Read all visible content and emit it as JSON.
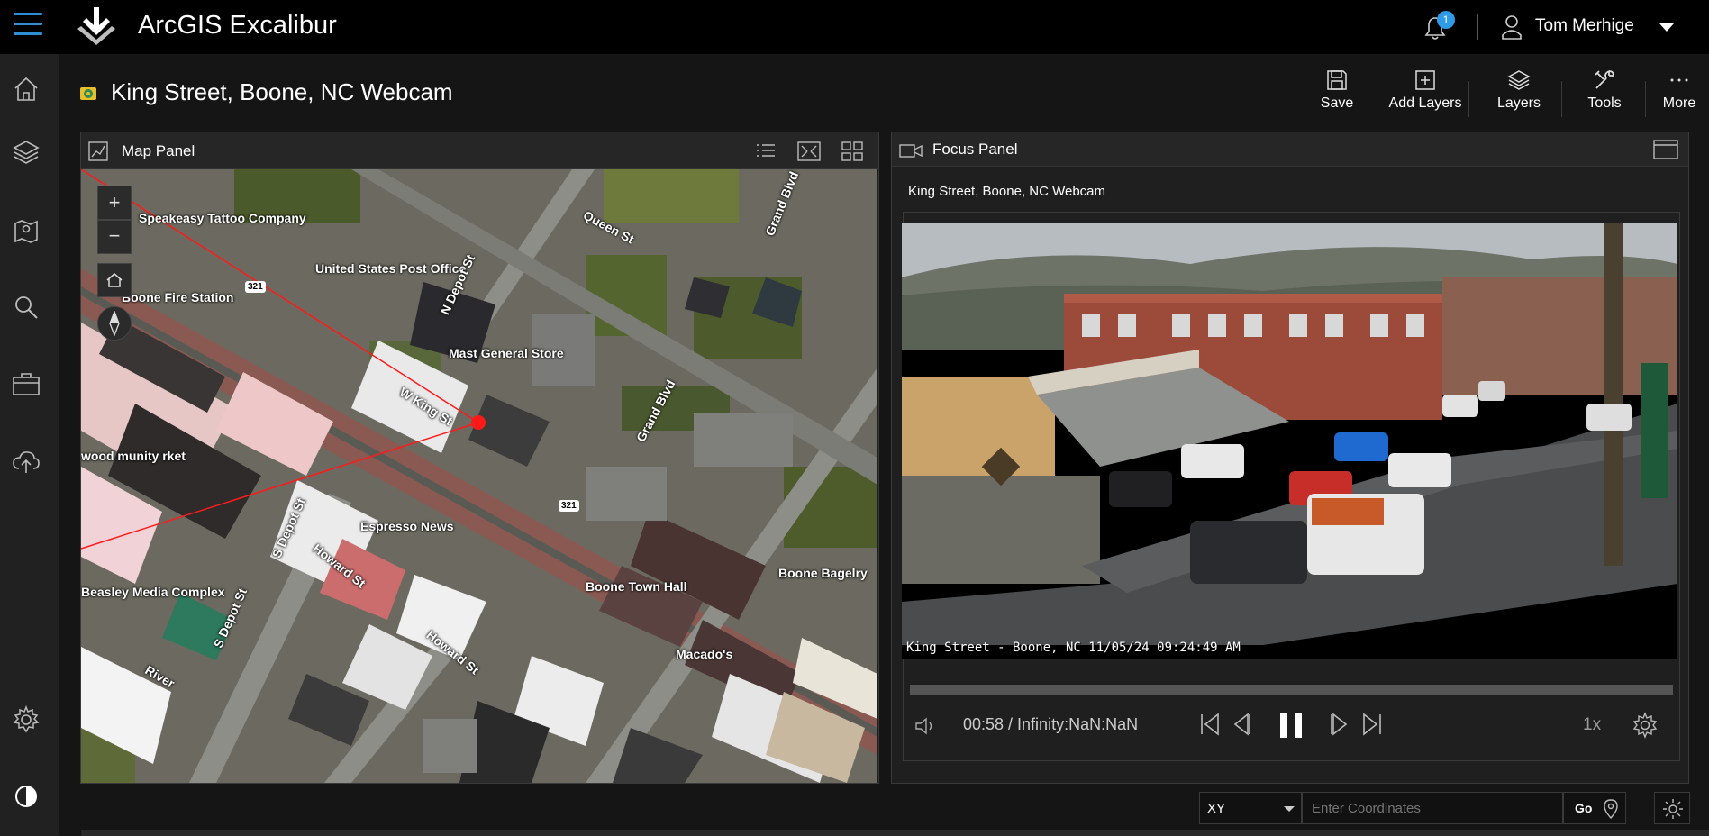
{
  "app": {
    "title": "ArcGIS Excalibur"
  },
  "notifications": {
    "count": "1"
  },
  "user": {
    "name": "Tom Merhige"
  },
  "page": {
    "title": "King Street, Boone, NC Webcam"
  },
  "toolbar": {
    "save": "Save",
    "add_layers": "Add Layers",
    "layers": "Layers",
    "tools": "Tools",
    "more": "More"
  },
  "map_panel": {
    "title": "Map Panel",
    "labels": {
      "speakeasy": "Speakeasy Tattoo Company",
      "post_office": "United States Post Office",
      "queen_st": "Queen St",
      "grand_blvd_top": "Grand Blvd",
      "n_depot": "N Depot St",
      "mast_general": "Mast General Store",
      "w_king": "W King St",
      "grand_blvd_mid": "Grand Blvd",
      "boone_fire": "Boone Fire Station",
      "wood_market": "wood munity rket",
      "espresso": "Espresso News",
      "s_depot_1": "S Depot St",
      "howard_1": "Howard St",
      "boone_bagelry": "Boone Bagelry",
      "beasley": "Beasley Media Complex",
      "s_depot_2": "S Depot St",
      "boone_town_hall": "Boone Town Hall",
      "howard_2": "Howard St",
      "macados": "Macado's",
      "river": "River",
      "route_321_a": "321",
      "route_321_b": "321"
    }
  },
  "focus_panel": {
    "title": "Focus Panel",
    "video_title": "King Street, Boone, NC Webcam",
    "overlay": "King Street - Boone, NC 11/05/24 09:24:49 AM",
    "time": "00:58 / Infinity:NaN:NaN",
    "speed": "1x",
    "progress": 0
  },
  "coords": {
    "format": "XY",
    "placeholder": "Enter Coordinates",
    "go": "Go"
  },
  "colors": {
    "accent": "#2f8fd6",
    "marker": "#ff1a1a"
  }
}
